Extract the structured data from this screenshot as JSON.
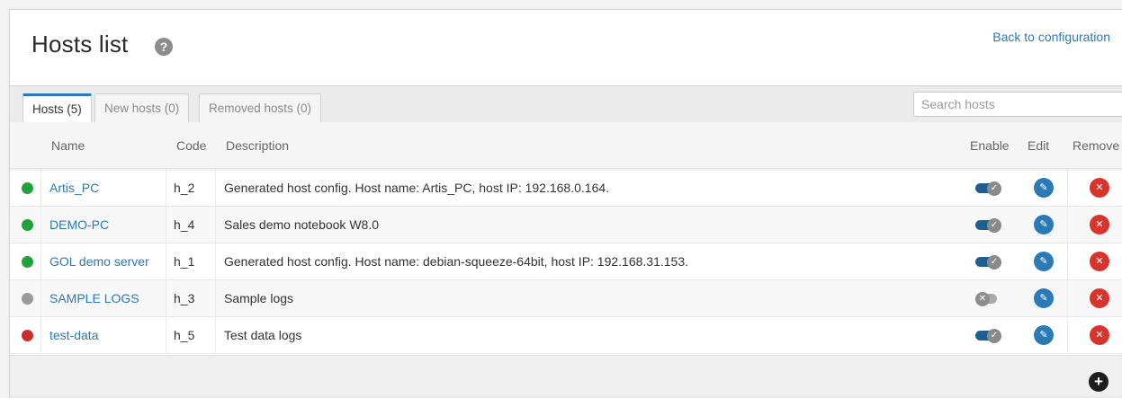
{
  "header": {
    "title": "Hosts list",
    "help_icon": "help-icon",
    "back_link": "Back to configuration"
  },
  "tabs": [
    {
      "label": "Hosts (5)",
      "active": true
    },
    {
      "label": "New hosts (0)",
      "active": false
    },
    {
      "label": "Removed hosts (0)",
      "active": false
    }
  ],
  "search": {
    "placeholder": "Search hosts",
    "value": ""
  },
  "table": {
    "columns": {
      "name": "Name",
      "code": "Code",
      "description": "Description",
      "enable": "Enable",
      "edit": "Edit",
      "remove": "Remove"
    },
    "rows": [
      {
        "status": "green",
        "name": "Artis_PC",
        "code": "h_2",
        "description": "Generated host config. Host name: Artis_PC, host IP: 192.168.0.164.",
        "enabled": true
      },
      {
        "status": "green",
        "name": "DEMO-PC",
        "code": "h_4",
        "description": "Sales demo notebook W8.0",
        "enabled": true
      },
      {
        "status": "green",
        "name": "GOL demo server",
        "code": "h_1",
        "description": "Generated host config. Host name: debian-squeeze-64bit, host IP: 192.168.31.153.",
        "enabled": true
      },
      {
        "status": "gray",
        "name": "SAMPLE LOGS",
        "code": "h_3",
        "description": "Sample logs",
        "enabled": false
      },
      {
        "status": "red",
        "name": "test-data",
        "code": "h_5",
        "description": "Test data logs",
        "enabled": true
      }
    ]
  },
  "icons": {
    "edit": "pencil-icon",
    "remove": "close-icon",
    "add": "plus-icon",
    "toggle_on": "check-icon",
    "toggle_off": "x-icon"
  },
  "colors": {
    "accent": "#2a7ab8",
    "status_green": "#22a13a",
    "status_gray": "#9a9a9a",
    "status_red": "#c9302c",
    "remove": "#d9342b",
    "toggle_on": "#1f5f8f"
  }
}
